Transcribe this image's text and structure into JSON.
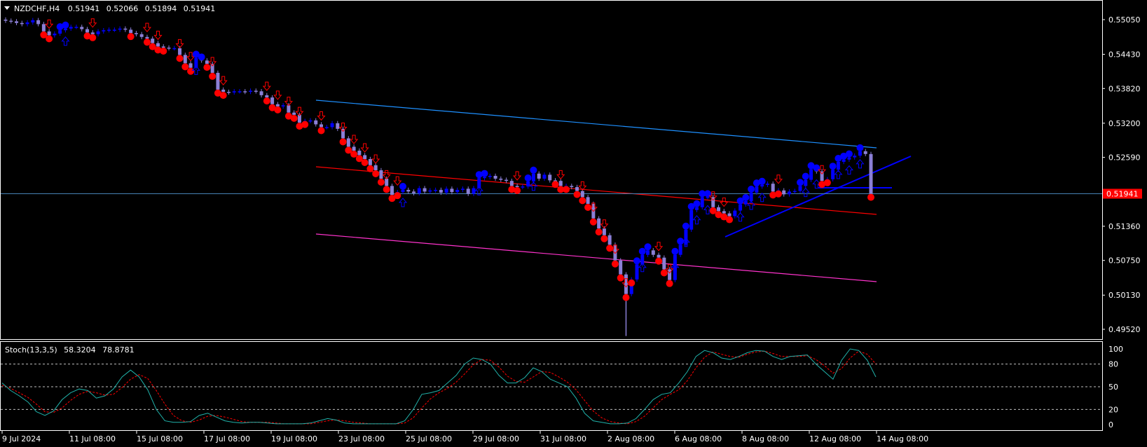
{
  "header": {
    "symbol": "NZDCHF,H4",
    "open": "0.51941",
    "high": "0.52066",
    "low": "0.51894",
    "close": "0.51941"
  },
  "indicator": {
    "label": "Stoch(13,3,5)",
    "main_value": "58.3204",
    "signal_value": "78.8781"
  },
  "colors": {
    "background": "#000000",
    "frame": "#ffffff",
    "text": "#ffffff",
    "bull_candle": "#0000ff",
    "bear_candle": "#8b7fd6",
    "down_dot": "#ff0000",
    "up_dot": "#0000ff",
    "down_arrow": "#ff0000",
    "up_arrow": "#0000ff",
    "channel_upper": "#1e90ff",
    "channel_middle": "#ff0000",
    "channel_lower": "#ff33cc",
    "trendline": "#0000ff",
    "current_price_line": "#4682b4",
    "price_tag_bg": "#ff0000",
    "stoch_main": "#20b2aa",
    "stoch_signal": "#ff0000"
  },
  "chart_data": [
    {
      "type": "candlestick",
      "title": "NZDCHF,H4",
      "x_labels": [
        "9 Jul 2024",
        "11 Jul 08:00",
        "15 Jul 08:00",
        "17 Jul 08:00",
        "19 Jul 08:00",
        "23 Jul 08:00",
        "25 Jul 08:00",
        "29 Jul 08:00",
        "31 Jul 08:00",
        "2 Aug 08:00",
        "6 Aug 08:00",
        "8 Aug 08:00",
        "12 Aug 08:00",
        "14 Aug 08:00"
      ],
      "y_ticks": [
        "0.55050",
        "0.54430",
        "0.53820",
        "0.53200",
        "0.52590",
        "0.51980",
        "0.51360",
        "0.50750",
        "0.50130",
        "0.49520"
      ],
      "ylim": [
        0.4915,
        0.554
      ],
      "current_price": "0.51941",
      "approx_close": [
        0.5503,
        0.5502,
        0.5499,
        0.5497,
        0.55,
        0.5504,
        0.5497,
        0.5484,
        0.5477,
        0.548,
        0.5486,
        0.5489,
        0.5492,
        0.5492,
        0.5488,
        0.5482,
        0.5479,
        0.5484,
        0.5486,
        0.5487,
        0.5487,
        0.5489,
        0.5487,
        0.5481,
        0.5479,
        0.5474,
        0.5471,
        0.5463,
        0.5457,
        0.5455,
        0.5454,
        0.5454,
        0.5442,
        0.5427,
        0.5419,
        0.5437,
        0.5432,
        0.5426,
        0.541,
        0.538,
        0.5376,
        0.5375,
        0.5377,
        0.5377,
        0.5376,
        0.5378,
        0.5377,
        0.537,
        0.5366,
        0.5354,
        0.535,
        0.5352,
        0.5339,
        0.5335,
        0.5321,
        0.5324,
        0.5325,
        0.5318,
        0.5313,
        0.5313,
        0.532,
        0.531,
        0.5293,
        0.5278,
        0.5271,
        0.5263,
        0.5256,
        0.5245,
        0.5236,
        0.5221,
        0.5208,
        0.5192,
        0.5197,
        0.5201,
        0.5198,
        0.5195,
        0.5204,
        0.5198,
        0.52,
        0.5201,
        0.5196,
        0.5203,
        0.5197,
        0.5201,
        0.5203,
        0.5194,
        0.5204,
        0.5222,
        0.5224,
        0.5226,
        0.5221,
        0.5219,
        0.5217,
        0.5208,
        0.5206,
        0.5207,
        0.5216,
        0.523,
        0.5221,
        0.5228,
        0.5218,
        0.5217,
        0.5208,
        0.5208,
        0.5206,
        0.5199,
        0.5188,
        0.5176,
        0.515,
        0.5132,
        0.512,
        0.5103,
        0.5075,
        0.505,
        0.5015,
        0.5041,
        0.5068,
        0.5085,
        0.5093,
        0.5085,
        0.508,
        0.5059,
        0.504,
        0.5085,
        0.5103,
        0.513,
        0.5165,
        0.517,
        0.5188,
        0.5188,
        0.517,
        0.5163,
        0.5159,
        0.5154,
        0.5164,
        0.5175,
        0.5181,
        0.5196,
        0.5207,
        0.521,
        0.5212,
        0.5198,
        0.52,
        0.5193,
        0.5198,
        0.5199,
        0.5208,
        0.5219,
        0.5238,
        0.5234,
        0.5217,
        0.522,
        0.5237,
        0.5251,
        0.5255,
        0.5259,
        0.5262,
        0.527,
        0.5265,
        0.5194
      ]
    },
    {
      "type": "line",
      "title": "Stoch(13,3,5)",
      "y_ticks": [
        "100",
        "80",
        "50",
        "20",
        "0"
      ],
      "ylim": [
        -5,
        103
      ],
      "levels": [
        80,
        50,
        20
      ],
      "series": [
        {
          "name": "main",
          "values": [
            55,
            45,
            38,
            30,
            17,
            12,
            18,
            33,
            42,
            47,
            45,
            35,
            38,
            47,
            63,
            72,
            63,
            46,
            20,
            5,
            3,
            3,
            4,
            12,
            15,
            10,
            5,
            3,
            2,
            3,
            3,
            2,
            1,
            1,
            1,
            1,
            2,
            5,
            8,
            6,
            2,
            1,
            1,
            1,
            1,
            1,
            1,
            5,
            20,
            40,
            42,
            45,
            55,
            65,
            80,
            88,
            86,
            80,
            65,
            55,
            55,
            62,
            75,
            70,
            60,
            55,
            50,
            35,
            15,
            5,
            3,
            1,
            1,
            2,
            8,
            20,
            33,
            40,
            42,
            55,
            70,
            90,
            98,
            95,
            88,
            86,
            90,
            95,
            98,
            97,
            90,
            86,
            90,
            91,
            92,
            80,
            70,
            60,
            85,
            100,
            98,
            85,
            63
          ]
        },
        {
          "name": "signal",
          "values": [
            52,
            48,
            42,
            36,
            27,
            17,
            16,
            22,
            32,
            40,
            44,
            42,
            39,
            40,
            49,
            60,
            66,
            61,
            45,
            27,
            12,
            5,
            3,
            6,
            11,
            12,
            10,
            7,
            4,
            3,
            3,
            3,
            2,
            1,
            1,
            1,
            1,
            3,
            5,
            6,
            5,
            3,
            2,
            1,
            1,
            1,
            1,
            2,
            9,
            22,
            34,
            42,
            48,
            56,
            67,
            79,
            86,
            85,
            76,
            64,
            57,
            56,
            63,
            70,
            69,
            63,
            56,
            46,
            32,
            18,
            9,
            4,
            2,
            1,
            4,
            11,
            22,
            33,
            40,
            46,
            58,
            75,
            89,
            96,
            93,
            90,
            89,
            93,
            96,
            97,
            94,
            90,
            90,
            90,
            91,
            86,
            78,
            68,
            74,
            88,
            97,
            93,
            80
          ]
        }
      ]
    }
  ]
}
